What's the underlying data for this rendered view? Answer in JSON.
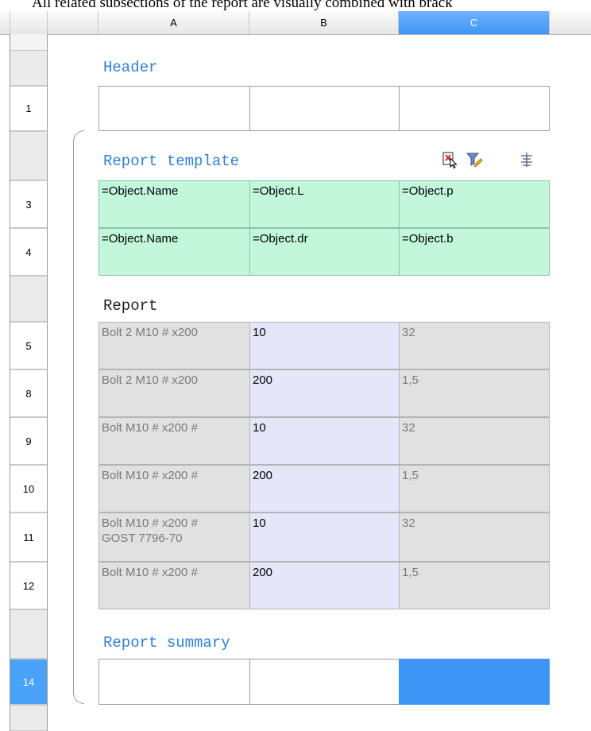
{
  "caption": "All related subsections of the report are visually combined with brack",
  "columns": [
    "A",
    "B",
    "C"
  ],
  "rows": {
    "header": "1",
    "t1": "3",
    "t2": "4",
    "r1": "5",
    "r2": "8",
    "r3": "9",
    "r4": "10",
    "r5": "11",
    "r6": "12",
    "summary": "14"
  },
  "sections": {
    "header": "Header",
    "template": "Report template",
    "report": "Report",
    "summary": "Report summary"
  },
  "template_rows": [
    [
      "=Object.Name",
      "=Object.L",
      "=Object.p"
    ],
    [
      "=Object.Name",
      "=Object.dr",
      "=Object.b"
    ]
  ],
  "report_rows": [
    [
      "Bolt 2 M10 # x200",
      "10",
      "32"
    ],
    [
      "Bolt 2 M10 # x200",
      "200",
      "1,5"
    ],
    [
      "Bolt M10 # x200 #",
      "10",
      "32"
    ],
    [
      "Bolt M10 # x200 #",
      "200",
      "1,5"
    ],
    [
      "Bolt M10 # x200 #\nGOST 7796-70",
      "10",
      "32"
    ],
    [
      "Bolt M10 # x200 #",
      "200",
      "1,5"
    ]
  ],
  "icons": [
    "delete-section-icon",
    "filter-edit-icon",
    "align-settings-icon"
  ],
  "colors": {
    "selection": "#3d95f5",
    "template_fill": "#c2f7db",
    "section_title": "#2f7fd6",
    "report_value": "#e6e6fb",
    "report_gray": "#e1e1e1"
  }
}
